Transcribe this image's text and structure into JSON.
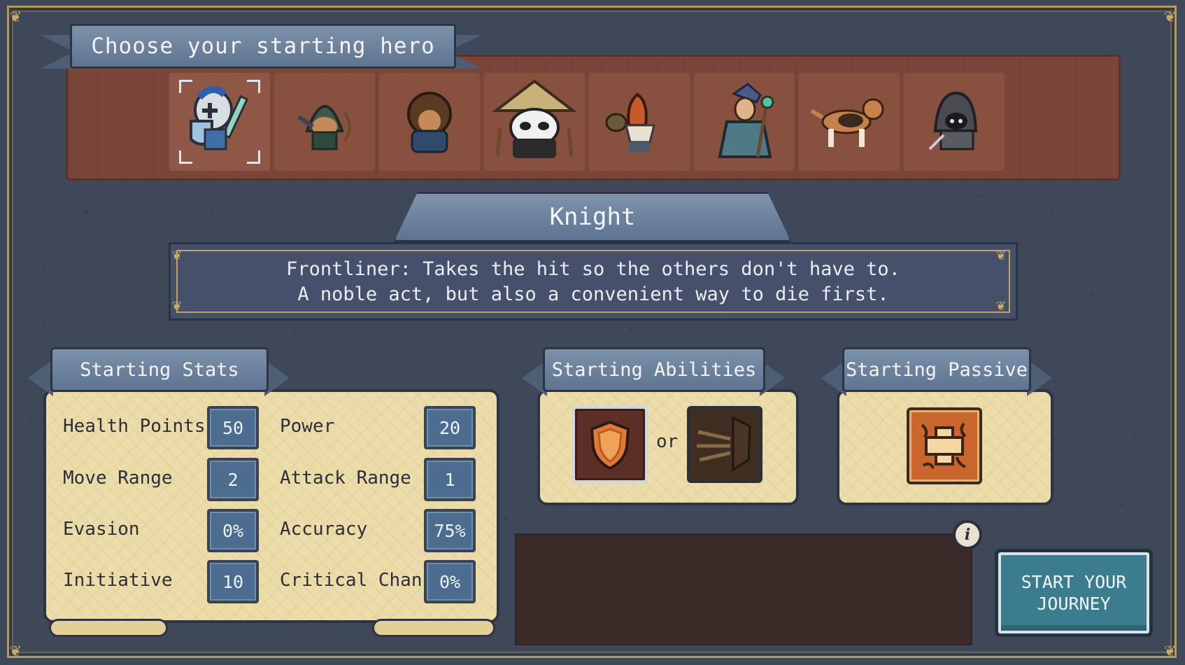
{
  "header": {
    "title": "Choose your starting hero"
  },
  "heroes": [
    {
      "name": "knight",
      "selected": true
    },
    {
      "name": "ranger",
      "selected": false
    },
    {
      "name": "bear",
      "selected": false
    },
    {
      "name": "panda-monk",
      "selected": false
    },
    {
      "name": "gnome-tinkerer",
      "selected": false
    },
    {
      "name": "mage",
      "selected": false
    },
    {
      "name": "beagle-dog",
      "selected": false
    },
    {
      "name": "hooded-rogue",
      "selected": false
    }
  ],
  "selected_hero": {
    "name": "Knight",
    "description_line1": "Frontliner: Takes the hit so the others don't have to.",
    "description_line2": "A noble act, but also a convenient way to die first."
  },
  "stats": {
    "title": "Starting Stats",
    "left": [
      {
        "label": "Health Points",
        "value": "50"
      },
      {
        "label": "Move Range",
        "value": "2"
      },
      {
        "label": "Evasion",
        "value": "0%"
      },
      {
        "label": "Initiative",
        "value": "10"
      }
    ],
    "right": [
      {
        "label": "Power",
        "value": "20"
      },
      {
        "label": "Attack Range",
        "value": "1"
      },
      {
        "label": "Accuracy",
        "value": "75%"
      },
      {
        "label": "Critical Chance",
        "value": "0%"
      }
    ]
  },
  "abilities": {
    "title": "Starting Abilities",
    "separator": "or",
    "items": [
      {
        "icon": "shield-icon"
      },
      {
        "icon": "charge-icon"
      }
    ]
  },
  "passive": {
    "title": "Starting Passive",
    "icon": "healing-cross-icon"
  },
  "info_button": {
    "label": "i"
  },
  "start_button": {
    "label": "START YOUR\nJOURNEY"
  }
}
